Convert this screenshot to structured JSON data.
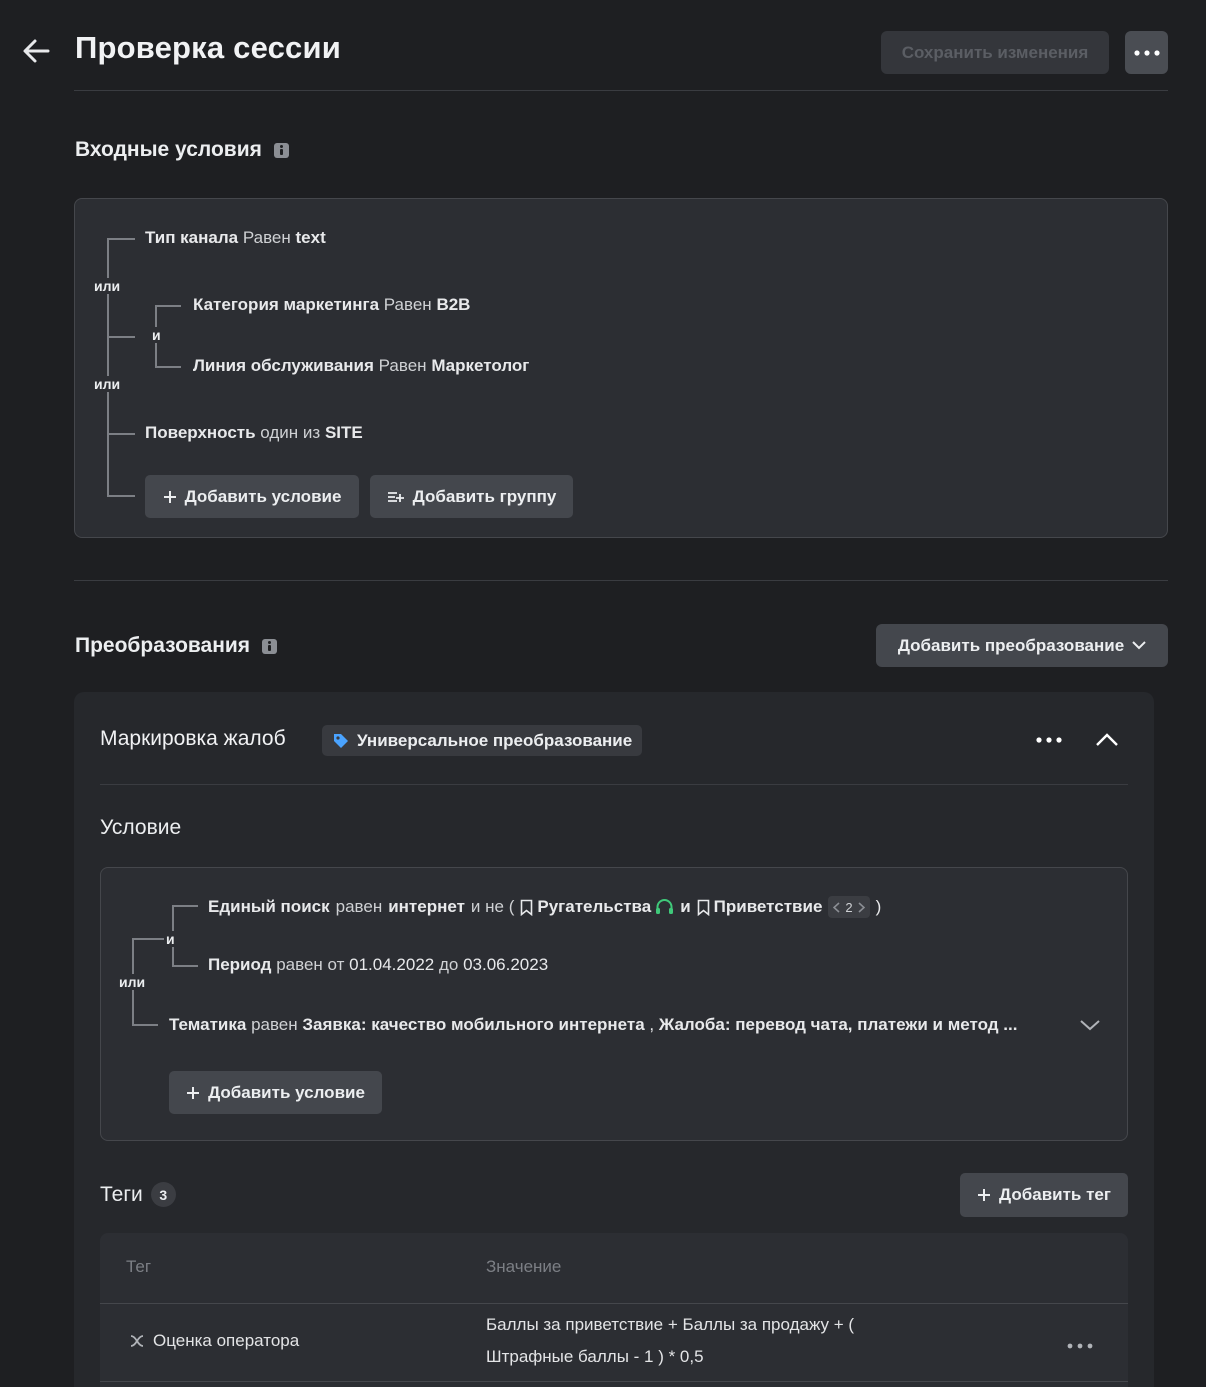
{
  "header": {
    "title": "Проверка сессии",
    "save_label": "Сохранить изменения"
  },
  "input_conditions": {
    "title": "Входные условия",
    "ops": {
      "or_1": "или",
      "and_1": "и",
      "or_2": "или"
    },
    "c1": {
      "field": "Тип канала",
      "op": "Равен",
      "value": "text"
    },
    "c2": {
      "field": "Категория маркетинга",
      "op": "Равен",
      "value": "B2B"
    },
    "c3": {
      "field": "Линия обслуживания",
      "op": "Равен",
      "value": "Маркетолог"
    },
    "c4": {
      "field": "Поверхность",
      "op": "один из",
      "value": "SITE"
    },
    "add_condition": "Добавить условие",
    "add_group": "Добавить группу"
  },
  "transforms": {
    "title": "Преобразования",
    "add_label": "Добавить преобразование",
    "card": {
      "title": "Маркировка жалоб",
      "badge": "Универсальное преобразование",
      "condition_title": "Условие",
      "ops": {
        "and": "и",
        "or": "или"
      },
      "r1": {
        "field": "Единый поиск",
        "op": "равен",
        "value": "интернет",
        "and_not": "и не (",
        "tag1": "Ругательства",
        "and": "и",
        "tag2": "Приветствие",
        "count": "2",
        "close": ")"
      },
      "r2": {
        "field": "Период",
        "op": "равен",
        "from": "от",
        "date_from": "01.04.2022",
        "to": "до",
        "date_to": "03.06.2023"
      },
      "r3": {
        "field": "Тематика",
        "op": "равен",
        "value1": "Заявка: качество мобильного интернета",
        "sep": ",",
        "value2": "Жалоба: перевод чата, платежи и метод ..."
      },
      "add_condition": "Добавить условие",
      "tags": {
        "title": "Теги",
        "count": "3",
        "add_label": "Добавить тег",
        "col_tag": "Тег",
        "col_value": "Значение",
        "rows": [
          {
            "tag": "Оценка оператора",
            "value_line1": "Баллы за приветствие + Баллы за продажу + (",
            "value_line2": "Штрафные баллы - 1 ) * 0,5"
          }
        ]
      }
    }
  },
  "colors": {
    "headset_icon": "#3fc97a",
    "tag_badge_icon": "#4aa3ff"
  }
}
